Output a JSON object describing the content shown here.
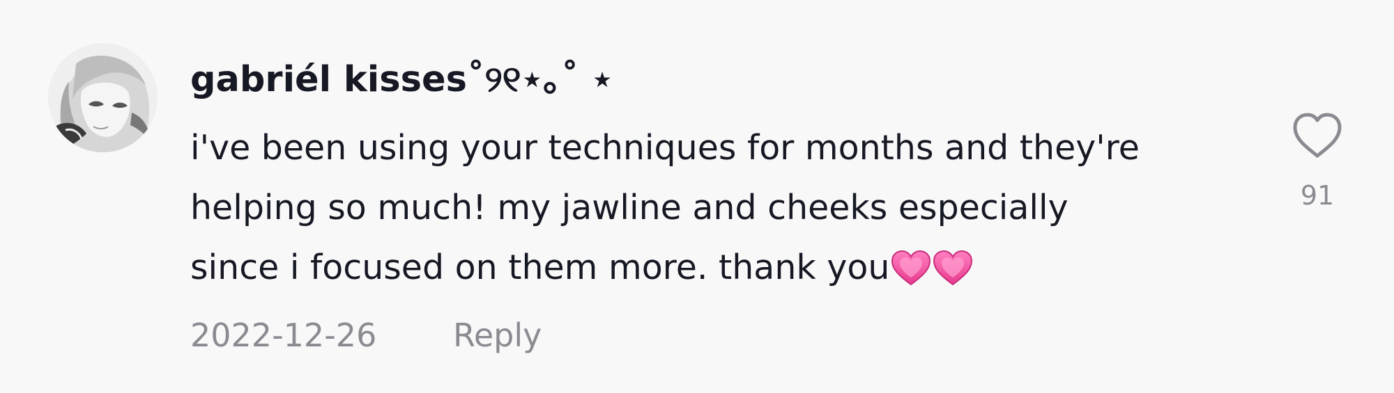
{
  "comment": {
    "username": "gabriél kisses˚୨୧⋆｡˚ ⋆",
    "text_lines": [
      "i've been using your techniques for months and they're",
      "helping so much! my jawline and cheeks especially",
      "since i focused on them more. thank you"
    ],
    "trailing_emoji": [
      "heart-emoji",
      "heart-emoji"
    ],
    "date": "2022-12-26",
    "reply_label": "Reply",
    "like_count": "91"
  },
  "colors": {
    "background": "#f8f8f8",
    "text_primary": "#161823",
    "text_secondary": "#8a8b91",
    "emoji_pink": "#ee4f9c"
  }
}
